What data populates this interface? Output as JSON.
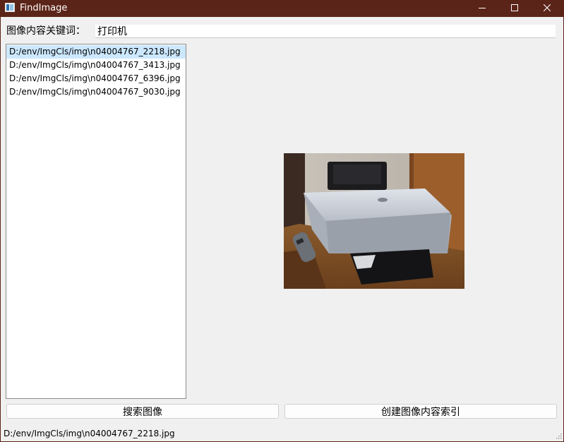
{
  "window": {
    "title": "FindImage",
    "icon": "app-image-icon",
    "controls": [
      "minimize-icon",
      "maximize-icon",
      "close-icon"
    ]
  },
  "search": {
    "label": "图像内容关键词：",
    "value": "打印机"
  },
  "results": {
    "items": [
      "D:/env/ImgCls/img\\n04004767_2218.jpg",
      "D:/env/ImgCls/img\\n04004767_3413.jpg",
      "D:/env/ImgCls/img\\n04004767_6396.jpg",
      "D:/env/ImgCls/img\\n04004767_9030.jpg"
    ],
    "selected_index": 0
  },
  "preview": {
    "subject": "printer-photo"
  },
  "buttons": {
    "search_label": "搜索图像",
    "index_label": "创建图像内容索引"
  },
  "status": {
    "text": "D:/env/ImgCls/img\\n04004767_2218.jpg"
  },
  "colors": {
    "titlebar": "#5b2418",
    "selection": "#cce8ff",
    "background": "#f0f0f0"
  }
}
